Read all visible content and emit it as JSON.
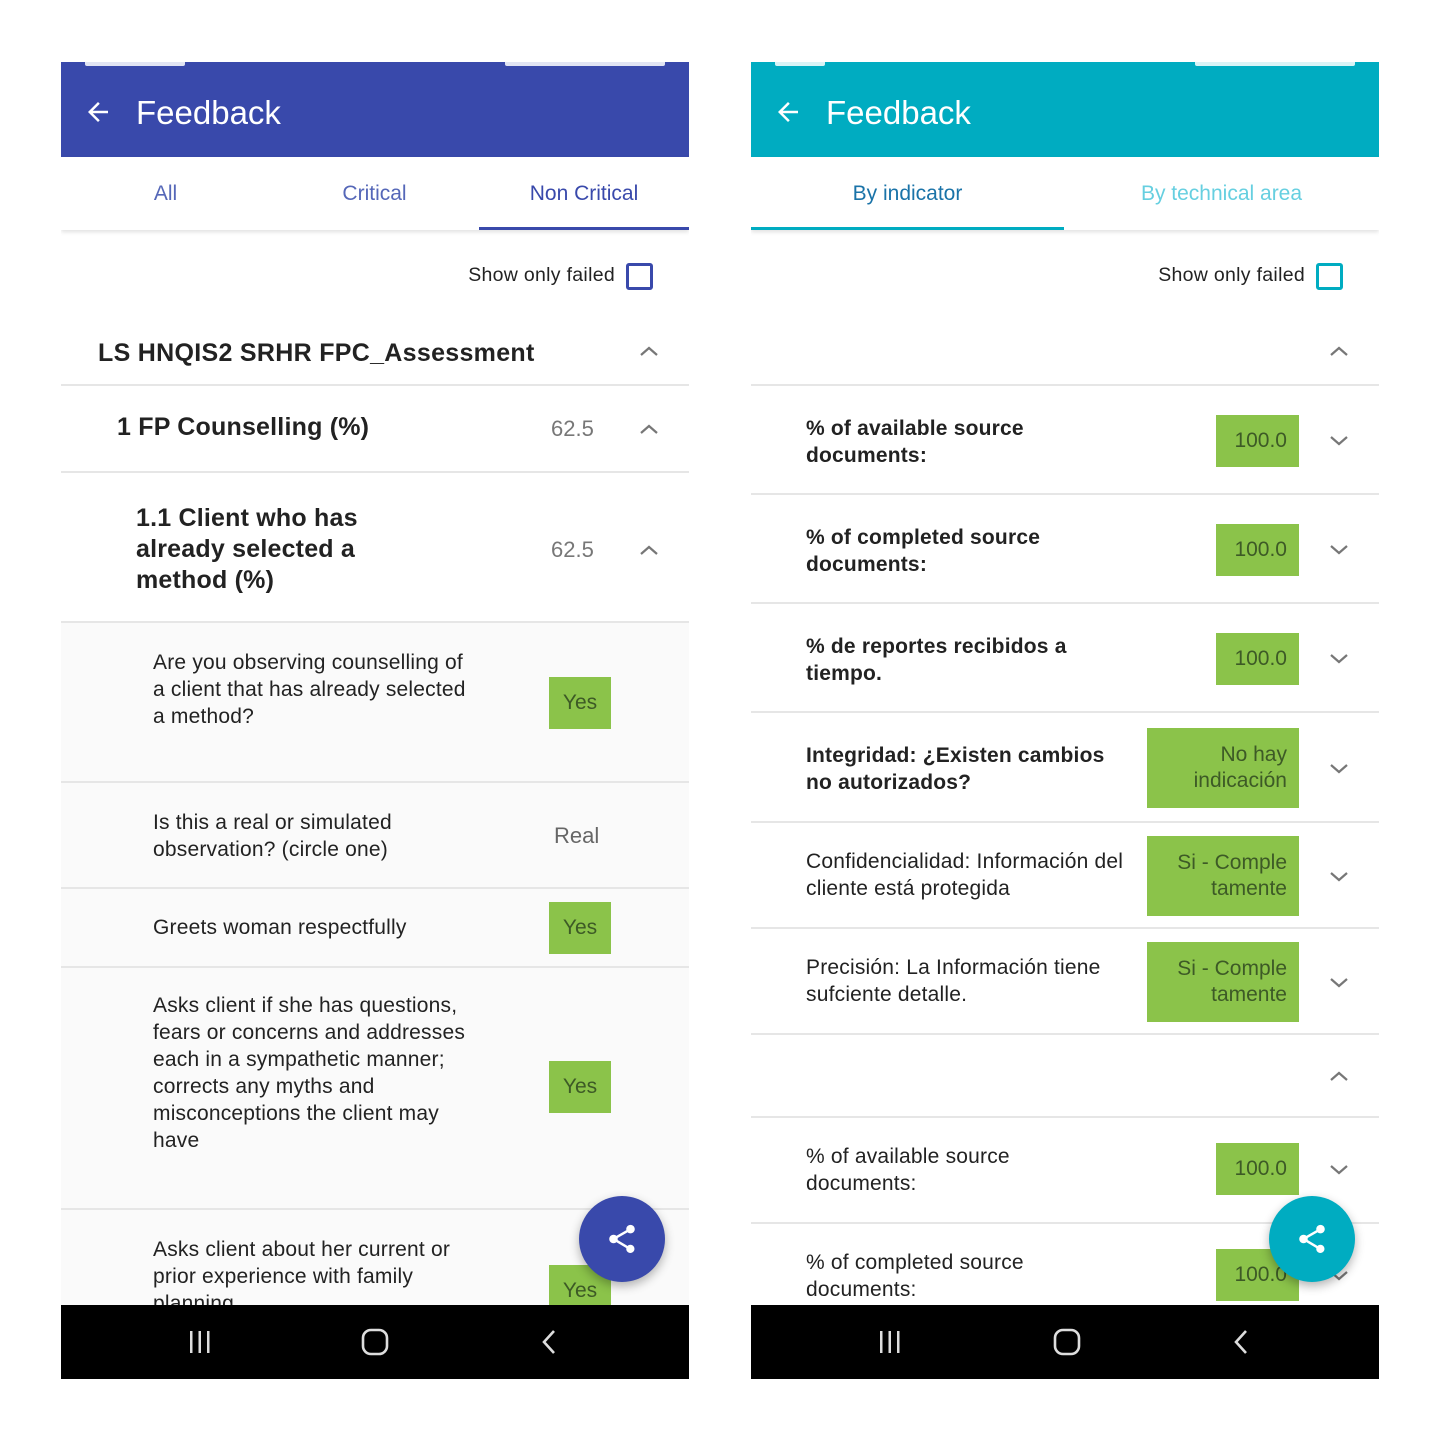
{
  "left": {
    "title": "Feedback",
    "tabs": [
      {
        "label": "All"
      },
      {
        "label": "Critical"
      },
      {
        "label": "Non Critical"
      }
    ],
    "filter_label": "Show only failed",
    "assessment": "LS HNQIS2 SRHR FPC_Assessment",
    "section": {
      "label": "1 FP Counselling (%)",
      "score": "62.5"
    },
    "subsection": {
      "label": "1.1 Client who has already selected a method (%)",
      "score": "62.5"
    },
    "questions": [
      {
        "text": "Are you observing counselling of a client that has already selected a method?",
        "answer": "Yes"
      },
      {
        "text": "Is this a real or simulated observation? (circle one)",
        "answer": "Real"
      },
      {
        "text": "Greets woman respectfully",
        "answer": "Yes"
      },
      {
        "text": "Asks client if she has questions, fears or concerns and addresses each in a sympathetic manner; corrects any myths and misconceptions the client may have",
        "answer": "Yes"
      },
      {
        "text": "Asks client about her current or prior experience with family planning",
        "answer": "Yes"
      }
    ]
  },
  "right": {
    "title": "Feedback",
    "tabs": [
      {
        "label": "By indicator"
      },
      {
        "label": "By technical area"
      }
    ],
    "filter_label": "Show only failed",
    "indicators": [
      {
        "text": "% of available source documents:",
        "value": "100.0"
      },
      {
        "text": "% of completed source documents:",
        "value": "100.0"
      },
      {
        "text": "% de reportes recibidos a tiempo.",
        "value": "100.0"
      },
      {
        "text": "Integridad: ¿Existen cambios no autorizados?",
        "value": "No hay indicación"
      },
      {
        "text": "Confidencialidad: Información del cliente está protegida",
        "value": "Si - Comple tamente"
      },
      {
        "text": "Precisión: La Información tiene sufciente detalle.",
        "value": "Si - Comple tamente"
      }
    ],
    "indicators2": [
      {
        "text": "% of available source documents:",
        "value": "100.0"
      },
      {
        "text": "% of completed source documents:",
        "value": "100.0"
      }
    ]
  },
  "icons": {
    "back": "arrow-left-icon",
    "share": "share-icon",
    "chevron_up": "chevron-up-icon",
    "chevron_down": "chevron-down-icon",
    "nav_recent": "recent-apps-icon",
    "nav_home": "home-icon",
    "nav_back": "nav-back-icon"
  },
  "colors": {
    "left_primary": "#3949ab",
    "right_primary": "#00acc1",
    "pass_badge": "#8bc34a"
  }
}
